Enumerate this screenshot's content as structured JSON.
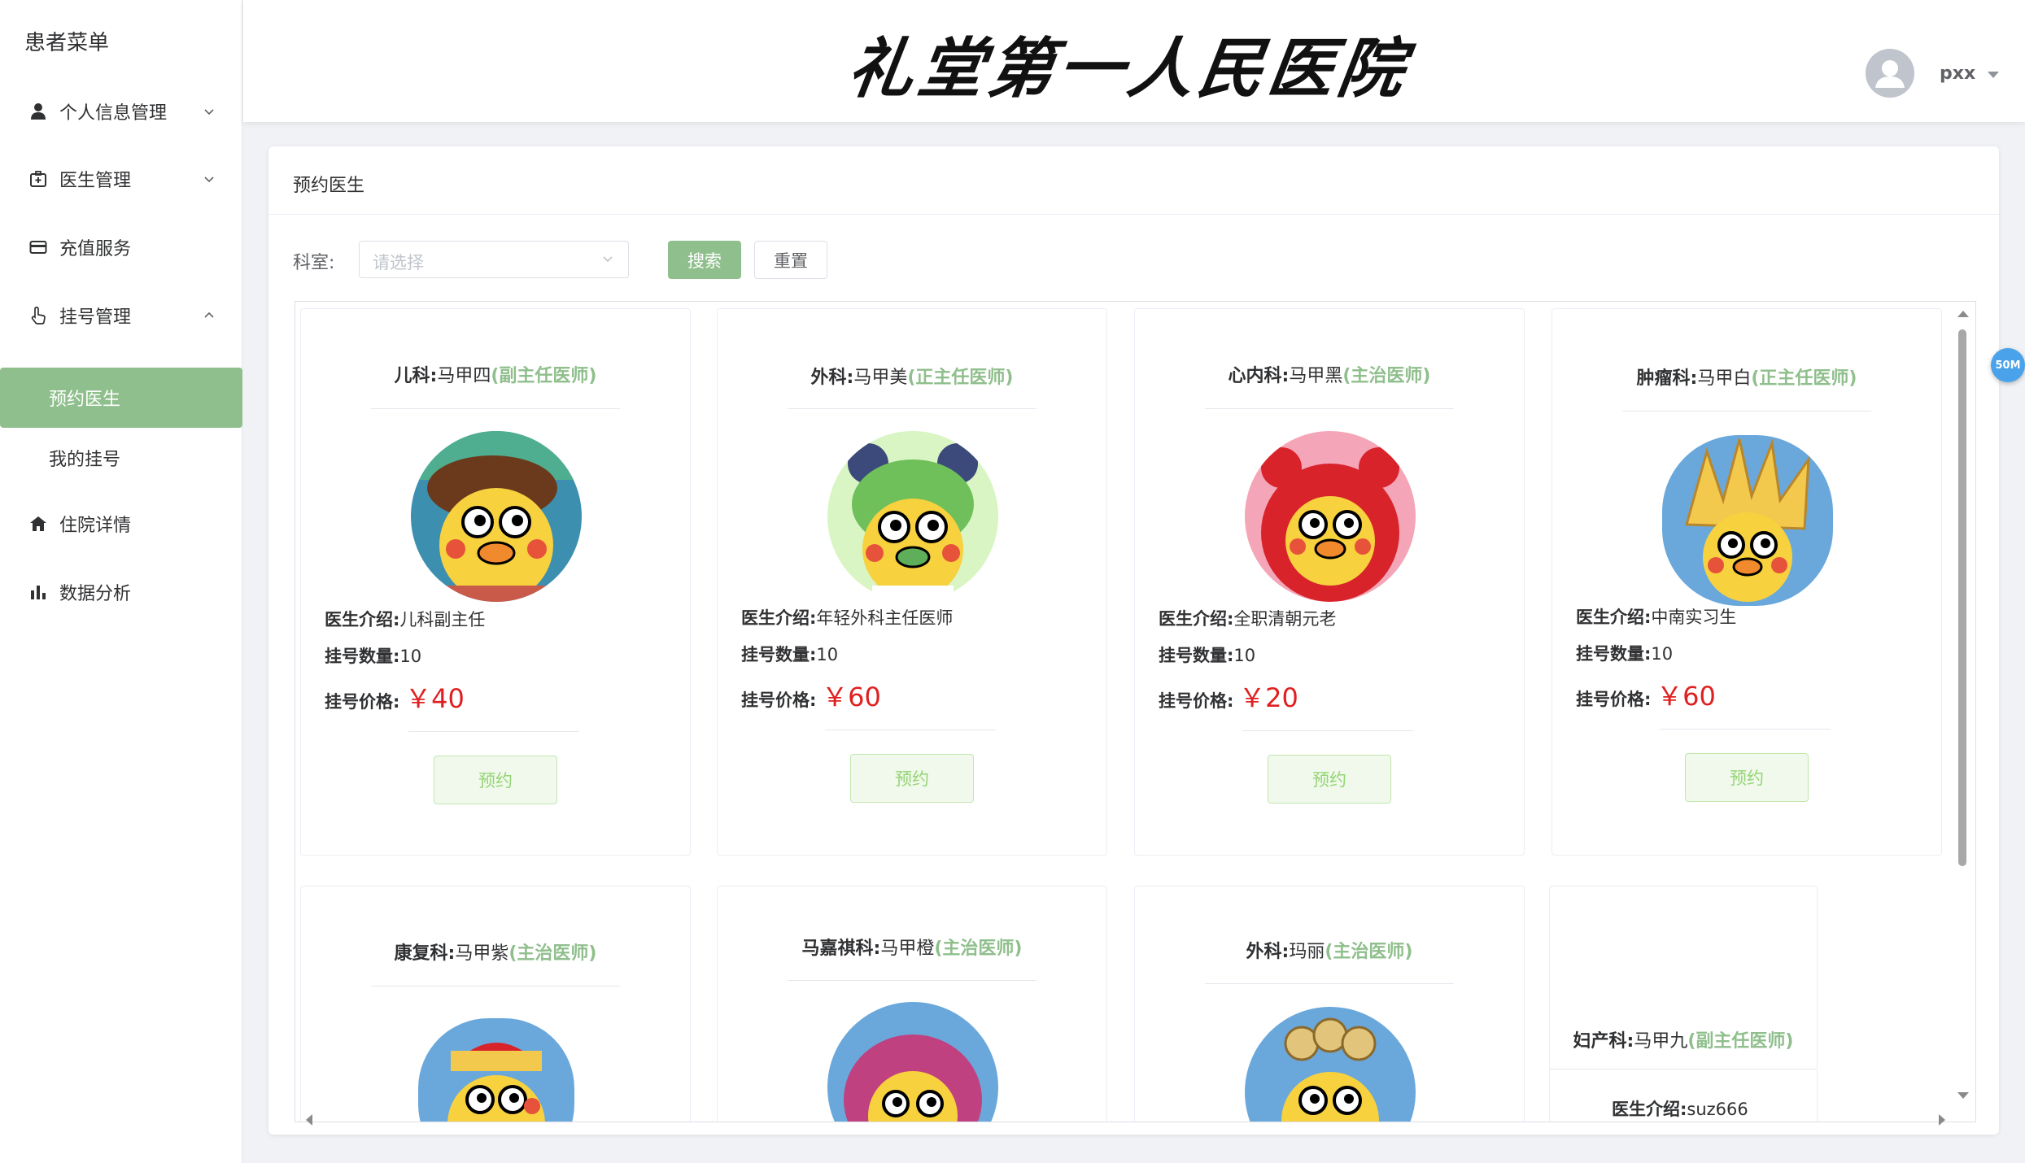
{
  "sidebar": {
    "title": "患者菜单",
    "items": [
      {
        "label": "个人信息管理",
        "icon": "user-icon",
        "expanded": false
      },
      {
        "label": "医生管理",
        "icon": "medical-kit-icon",
        "expanded": false
      },
      {
        "label": "充值服务",
        "icon": "credit-card-icon"
      },
      {
        "label": "挂号管理",
        "icon": "hand-pointer-icon",
        "expanded": true
      },
      {
        "label": "住院详情",
        "icon": "home-icon"
      },
      {
        "label": "数据分析",
        "icon": "bar-chart-icon"
      }
    ],
    "sub_items": [
      {
        "label": "预约医生",
        "active": true
      },
      {
        "label": "我的挂号",
        "active": false
      }
    ],
    "active_color": "#8fbf8c"
  },
  "header": {
    "hospital_name": "礼堂第一人民医院",
    "username": "pxx"
  },
  "main": {
    "title": "预约医生",
    "filter": {
      "label": "科室:",
      "placeholder": "请选择",
      "search_label": "搜索",
      "reset_label": "重置"
    },
    "labels": {
      "intro": "医生介绍:",
      "count": "挂号数量:",
      "price": "挂号价格:",
      "currency": "￥",
      "book": "预约"
    },
    "doctors": [
      {
        "dept": "儿科:",
        "name": "马甲四",
        "rank": "(副主任医师)",
        "intro": "儿科副主任",
        "count": "10",
        "price": "40",
        "avatar": "duck-hat-avatar"
      },
      {
        "dept": "外科:",
        "name": "马甲美",
        "rank": "(正主任医师)",
        "intro": "年轻外科主任医师",
        "count": "10",
        "price": "60",
        "avatar": "duck-green-hair-avatar"
      },
      {
        "dept": "心内科:",
        "name": "马甲黑",
        "rank": "(主治医师)",
        "intro": "全职清朝元老",
        "count": "10",
        "price": "20",
        "avatar": "duck-red-hood-avatar"
      },
      {
        "dept": "肿瘤科:",
        "name": "马甲白",
        "rank": "(正主任医师)",
        "intro": "中南实习生",
        "count": "10",
        "price": "60",
        "avatar": "duck-spiky-hair-avatar"
      },
      {
        "dept": "康复科:",
        "name": "马甲紫",
        "rank": "(主治医师)",
        "avatar": "duck-cap-avatar"
      },
      {
        "dept": "马嘉祺科:",
        "name": "马甲橙",
        "rank": "(主治医师)",
        "avatar": "duck-purple-hair-avatar"
      },
      {
        "dept": "外科:",
        "name": "玛丽",
        "rank": "(主治医师)",
        "avatar": "duck-curly-hair-avatar"
      },
      {
        "dept": "妇产科:",
        "name": "马甲九",
        "rank": "(副主任医师)",
        "intro": "suz666"
      }
    ]
  },
  "badge": "50M",
  "colors": {
    "accent": "#8fbf8c",
    "price": "#e02020",
    "rank": "#8fbf8c"
  }
}
